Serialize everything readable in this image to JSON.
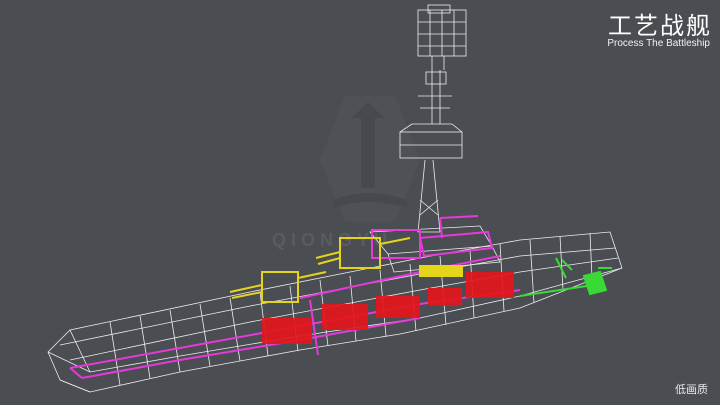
{
  "video": {
    "title_cn": "工艺战舰",
    "title_en": "Process The Battleship",
    "quality_label": "低画质",
    "watermark_text": "QIONGYU"
  },
  "colors": {
    "background": "#4a4d52",
    "wireframe": "#ffffff",
    "hull_magenta": "#e53ad8",
    "compartment_red": "#e4161b",
    "turret_yellow": "#e5d51a",
    "accent_green": "#39d936"
  }
}
